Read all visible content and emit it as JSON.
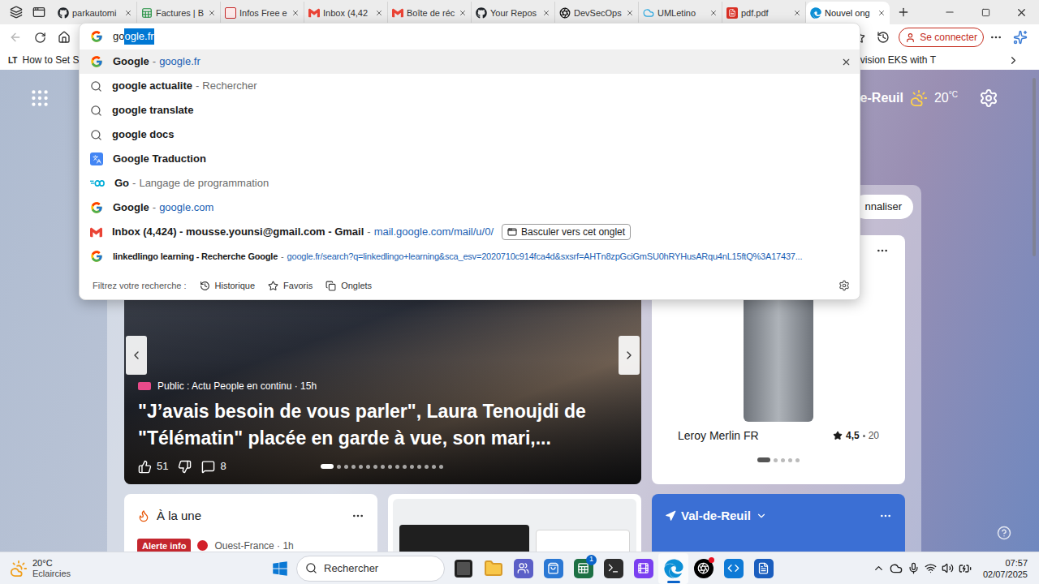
{
  "browser": {
    "tabs": [
      {
        "label": "parkautomi",
        "kind": "github",
        "selected": false
      },
      {
        "label": "Factures | B",
        "kind": "sheet",
        "selected": false
      },
      {
        "label": "Infos Free e",
        "kind": "free",
        "selected": false
      },
      {
        "label": "Inbox (4,42",
        "kind": "gmail",
        "selected": false
      },
      {
        "label": "Boîte de réc",
        "kind": "gmail",
        "selected": false
      },
      {
        "label": "Your Repos",
        "kind": "github",
        "selected": false
      },
      {
        "label": "DevSecOps",
        "kind": "chatgpt",
        "selected": false
      },
      {
        "label": "UMLetino",
        "kind": "umletino",
        "selected": false
      },
      {
        "label": "pdf.pdf",
        "kind": "pdf",
        "selected": false
      },
      {
        "label": "Nouvel ong",
        "kind": "edge",
        "selected": true
      }
    ],
    "toolbar": {
      "back_disabled": true,
      "sign_in": "Se connecter"
    },
    "address": {
      "typed": "go",
      "completion": "ogle.fr"
    },
    "favorites_bar": {
      "left": {
        "badge": "LT",
        "label": "How to Set Stat"
      },
      "right": {
        "label": "Provision EKS with T"
      }
    }
  },
  "omnibox": {
    "suggestions": [
      {
        "kind": "site",
        "title": "Google",
        "separator": "-",
        "detail": "google.fr",
        "selected": true
      },
      {
        "kind": "search",
        "title": "google actualite",
        "separator": "-",
        "detail": "Rechercher",
        "selected": false
      },
      {
        "kind": "search",
        "title": "google translate",
        "separator": "",
        "detail": "",
        "selected": false
      },
      {
        "kind": "search",
        "title": "google docs",
        "separator": "",
        "detail": "",
        "selected": false
      },
      {
        "kind": "translate",
        "title": "Google Traduction",
        "separator": "",
        "detail": "",
        "selected": false
      },
      {
        "kind": "go",
        "title": "Go",
        "separator": "-",
        "detail": "Langage de programmation",
        "selected": false
      },
      {
        "kind": "site",
        "title": "Google",
        "separator": "-",
        "detail": "google.com",
        "selected": false
      },
      {
        "kind": "gmail",
        "title": "Inbox (4,424) - mousse.younsi@gmail.com - Gmail",
        "separator": "-",
        "detail": "mail.google.com/mail/u/0/",
        "switch_button": "Basculer vers cet onglet",
        "selected": false
      },
      {
        "kind": "site",
        "title": "linkedlingo learning - Recherche Google",
        "separator": "-",
        "detail": "google.fr/search?q=linkedlingo+learning&sca_esv=2020710c914fca4d&sxsrf=AHTn8zpGciGmSU0hRYHusARqu4nL15ftQ%3A17437...",
        "selected": false
      }
    ],
    "filter": {
      "label": "Filtrez votre recherche :",
      "items": [
        {
          "label": "Historique",
          "kind": "history"
        },
        {
          "label": "Favoris",
          "kind": "favorites"
        },
        {
          "label": "Onglets",
          "kind": "tabs"
        }
      ]
    }
  },
  "page": {
    "weather": {
      "location": "de-Reuil",
      "temp": "20",
      "unit": "°C"
    },
    "personalize": "nnaliser",
    "news": {
      "meta": "Public : Actu People en continu · 15h",
      "headline": "\"J’avais besoin de vous parler\", Laura Tenoujdi de \"Télématin\" placée en garde à vue, son mari,...",
      "likes": "51",
      "comments": "8",
      "dots": [
        {
          "selected": true
        },
        {
          "selected": false
        },
        {
          "selected": false
        },
        {
          "selected": false
        },
        {
          "selected": false
        },
        {
          "selected": false
        },
        {
          "selected": false
        },
        {
          "selected": false
        },
        {
          "selected": false
        },
        {
          "selected": false
        },
        {
          "selected": false
        },
        {
          "selected": false
        },
        {
          "selected": false
        },
        {
          "selected": false
        },
        {
          "selected": false
        },
        {
          "selected": false
        }
      ]
    },
    "ad": {
      "brand": "Leroy Merlin FR",
      "rating": "4,5",
      "reviews": "20",
      "dots": [
        {
          "selected": true
        },
        {
          "selected": false
        },
        {
          "selected": false
        },
        {
          "selected": false
        },
        {
          "selected": false
        }
      ]
    },
    "headlines": {
      "title": "À la une",
      "badge": "Alerte info",
      "meta": "Ouest-France · 1h"
    },
    "local_weather": {
      "title": "Val-de-Reuil"
    }
  },
  "taskbar": {
    "weather": {
      "temp": "20°C",
      "condition": "Eclaircies"
    },
    "search": "Rechercher",
    "apps": [
      {
        "kind": "taskview",
        "selected": false,
        "badge": "",
        "notification": false
      },
      {
        "kind": "explorer",
        "selected": false,
        "badge": "",
        "notification": false
      },
      {
        "kind": "teams",
        "selected": false,
        "badge": "",
        "notification": false
      },
      {
        "kind": "store",
        "selected": false,
        "badge": "",
        "notification": false
      },
      {
        "kind": "excel",
        "selected": false,
        "badge": "1",
        "notification": false
      },
      {
        "kind": "terminal",
        "selected": false,
        "badge": "",
        "notification": false
      },
      {
        "kind": "clipchamp",
        "selected": false,
        "badge": "",
        "notification": false
      },
      {
        "kind": "edge",
        "selected": true,
        "badge": "",
        "notification": false
      },
      {
        "kind": "chatgpt",
        "selected": false,
        "badge": "",
        "notification": true
      },
      {
        "kind": "vscode",
        "selected": false,
        "badge": "",
        "notification": false
      },
      {
        "kind": "word",
        "selected": false,
        "badge": "",
        "notification": false
      }
    ],
    "time": "07:57",
    "date": "02/07/2025"
  }
}
